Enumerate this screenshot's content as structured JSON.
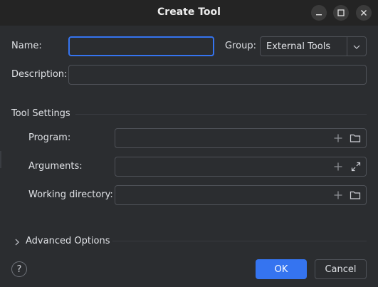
{
  "window": {
    "title": "Create Tool",
    "minimize_icon": "minimize-icon",
    "maximize_icon": "maximize-icon",
    "close_icon": "close-icon"
  },
  "form": {
    "name_label": "Name:",
    "name_value": "",
    "group_label": "Group:",
    "group_value": "External Tools",
    "description_label": "Description:",
    "description_value": ""
  },
  "tool_settings": {
    "section_title": "Tool Settings",
    "program_label": "Program:",
    "program_value": "",
    "arguments_label": "Arguments:",
    "arguments_value": "",
    "working_dir_label": "Working directory:",
    "working_dir_value": ""
  },
  "advanced": {
    "label": "Advanced Options"
  },
  "footer": {
    "help_label": "?",
    "ok_label": "OK",
    "cancel_label": "Cancel"
  },
  "colors": {
    "accent": "#3574f0",
    "background": "#2b2d30",
    "titlebar": "#242424",
    "border": "#4e5157"
  }
}
